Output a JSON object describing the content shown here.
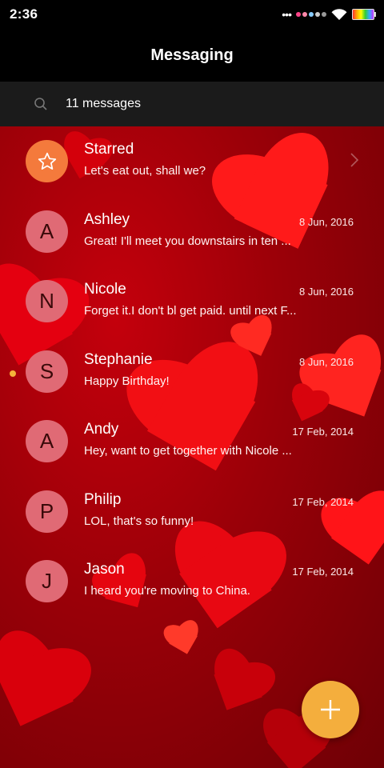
{
  "status_bar": {
    "time": "2:36"
  },
  "app_bar": {
    "title": "Messaging"
  },
  "search": {
    "label": "11 messages"
  },
  "conversations": [
    {
      "initial": "",
      "name": "Starred",
      "date": "",
      "preview": "Let's eat out, shall we?"
    },
    {
      "initial": "A",
      "name": "Ashley",
      "date": "8 Jun, 2016",
      "preview": "Great! I'll meet you downstairs in ten ..."
    },
    {
      "initial": "N",
      "name": "Nicole",
      "date": "8 Jun, 2016",
      "preview": "Forget it.I don't bl get paid. until next F..."
    },
    {
      "initial": "S",
      "name": "Stephanie",
      "date": "8 Jun, 2016",
      "preview": "Happy Birthday!"
    },
    {
      "initial": "A",
      "name": "Andy",
      "date": "17 Feb, 2014",
      "preview": "Hey, want to get together with Nicole ..."
    },
    {
      "initial": "P",
      "name": "Philip",
      "date": "17 Feb, 2014",
      "preview": "LOL, that's so funny!"
    },
    {
      "initial": "J",
      "name": "Jason",
      "date": "17 Feb, 2014",
      "preview": "I heard you're moving to China."
    }
  ],
  "colors": {
    "accent": "#f4ae3d",
    "avatar": "#e06a75",
    "starred_avatar": "#f47a3c",
    "unread": "#f5b23a"
  },
  "icons": {
    "search": "search-icon",
    "star": "star-icon",
    "compose": "plus-icon",
    "chevron": "chevron-right-icon"
  }
}
